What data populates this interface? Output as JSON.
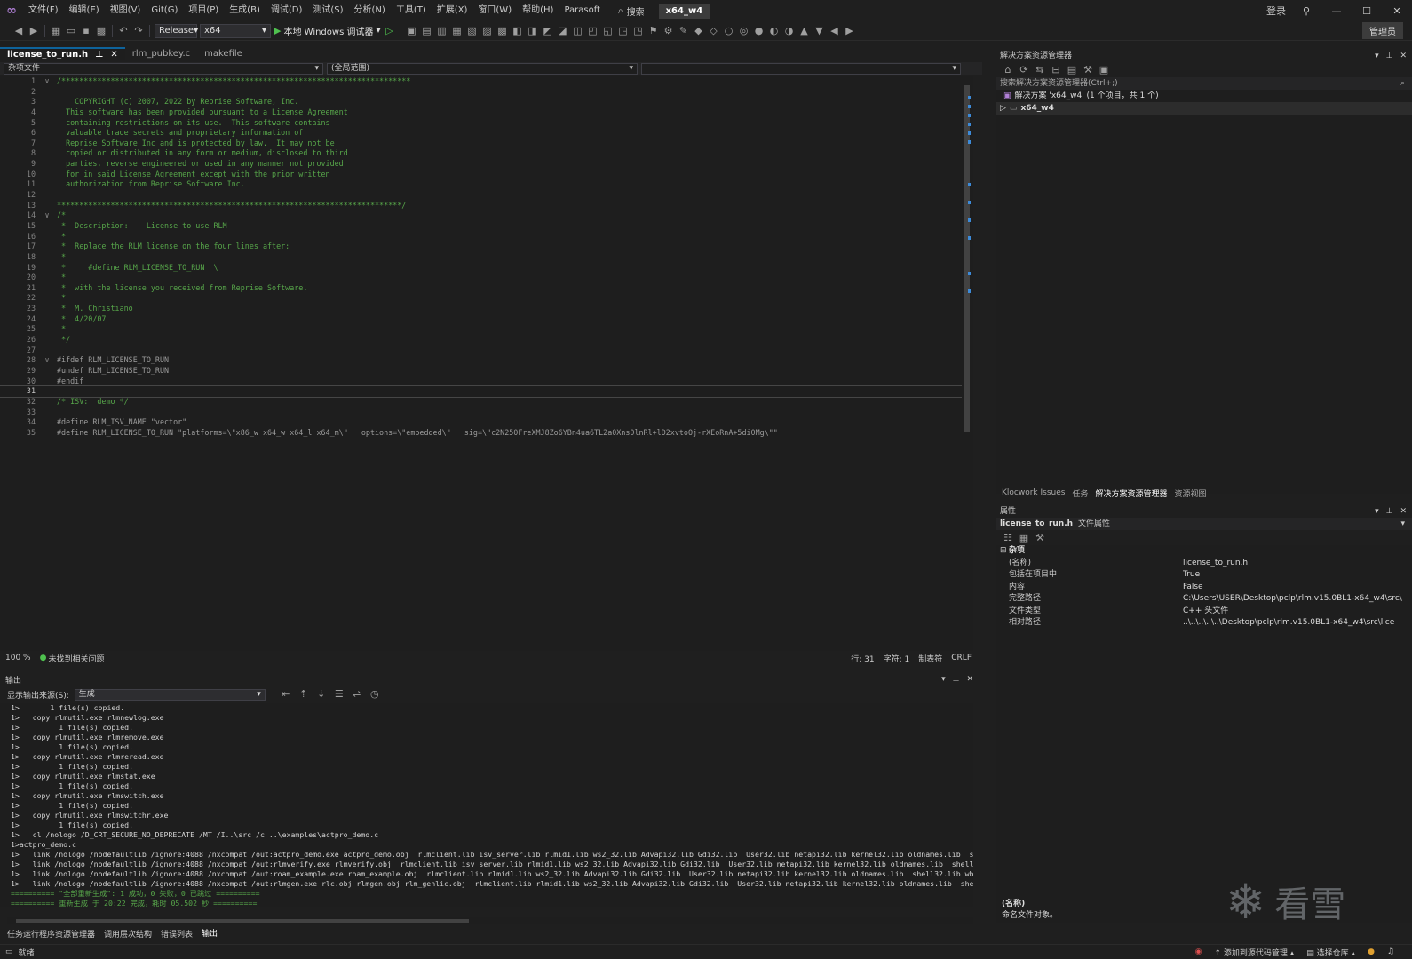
{
  "titlebar": {
    "menus": [
      "文件(F)",
      "编辑(E)",
      "视图(V)",
      "Git(G)",
      "项目(P)",
      "生成(B)",
      "调试(D)",
      "测试(S)",
      "分析(N)",
      "工具(T)",
      "扩展(X)",
      "窗口(W)",
      "帮助(H)",
      "Parasoft"
    ],
    "search_label": "搜索",
    "project_name": "x64_w4",
    "login_label": "登录"
  },
  "toolbar": {
    "configuration": "Release",
    "platform": "x64",
    "run_label": "本地 Windows 调试器",
    "admin_label": "管理员"
  },
  "editor": {
    "tabs": [
      {
        "label": "license_to_run.h",
        "active": true
      },
      {
        "label": "rlm_pubkey.c",
        "active": false
      },
      {
        "label": "makefile",
        "active": false
      }
    ],
    "nav_left": "杂项文件",
    "nav_middle": "(全局范围)",
    "lines": [
      {
        "n": "1",
        "text": "/******************************************************************************",
        "cls": ""
      },
      {
        "n": "2",
        "text": "",
        "cls": ""
      },
      {
        "n": "3",
        "text": "    COPYRIGHT (c) 2007, 2022 by Reprise Software, Inc.",
        "cls": ""
      },
      {
        "n": "4",
        "text": "  This software has been provided pursuant to a License Agreement",
        "cls": ""
      },
      {
        "n": "5",
        "text": "  containing restrictions on its use.  This software contains",
        "cls": ""
      },
      {
        "n": "6",
        "text": "  valuable trade secrets and proprietary information of",
        "cls": ""
      },
      {
        "n": "7",
        "text": "  Reprise Software Inc and is protected by law.  It may not be",
        "cls": ""
      },
      {
        "n": "8",
        "text": "  copied or distributed in any form or medium, disclosed to third",
        "cls": ""
      },
      {
        "n": "9",
        "text": "  parties, reverse engineered or used in any manner not provided",
        "cls": ""
      },
      {
        "n": "10",
        "text": "  for in said License Agreement except with the prior written",
        "cls": ""
      },
      {
        "n": "11",
        "text": "  authorization from Reprise Software Inc.",
        "cls": ""
      },
      {
        "n": "12",
        "text": "",
        "cls": ""
      },
      {
        "n": "13",
        "text": "*****************************************************************************/",
        "cls": ""
      },
      {
        "n": "14",
        "text": "/*",
        "cls": ""
      },
      {
        "n": "15",
        "text": " *  Description:    License to use RLM",
        "cls": ""
      },
      {
        "n": "16",
        "text": " *",
        "cls": ""
      },
      {
        "n": "17",
        "text": " *  Replace the RLM license on the four lines after:",
        "cls": ""
      },
      {
        "n": "18",
        "text": " *",
        "cls": ""
      },
      {
        "n": "19",
        "text": " *     #define RLM_LICENSE_TO_RUN  \\",
        "cls": ""
      },
      {
        "n": "20",
        "text": " *",
        "cls": ""
      },
      {
        "n": "21",
        "text": " *  with the license you received from Reprise Software.",
        "cls": ""
      },
      {
        "n": "22",
        "text": " *",
        "cls": ""
      },
      {
        "n": "23",
        "text": " *  M. Christiano",
        "cls": ""
      },
      {
        "n": "24",
        "text": " *  4/20/07",
        "cls": ""
      },
      {
        "n": "25",
        "text": " *",
        "cls": ""
      },
      {
        "n": "26",
        "text": " */",
        "cls": ""
      },
      {
        "n": "27",
        "text": "",
        "cls": ""
      },
      {
        "n": "28",
        "text": "#ifdef RLM_LICENSE_TO_RUN",
        "cls": "pp"
      },
      {
        "n": "29",
        "text": "#undef RLM_LICENSE_TO_RUN",
        "cls": "pp"
      },
      {
        "n": "30",
        "text": "#endif",
        "cls": "pp"
      },
      {
        "n": "31",
        "text": "",
        "cls": "pp"
      },
      {
        "n": "32",
        "text": "/* ISV:  demo */",
        "cls": ""
      },
      {
        "n": "33",
        "text": "",
        "cls": ""
      },
      {
        "n": "34",
        "text": "#define RLM_ISV_NAME \"vector\"",
        "cls": "pp"
      },
      {
        "n": "35",
        "text": "#define RLM_LICENSE_TO_RUN \"platforms=\\\"x86_w x64_w x64_l x64_m\\\"   options=\\\"embedded\\\"   sig=\\\"c2N250FreXMJ8Zo6YBn4ua6TL2a0Xns0lnRl+lD2xvtoOj-rXEoRnA+5di0Mg\\\"\"",
        "cls": "pp"
      }
    ],
    "status": {
      "zoom": "100 %",
      "issues": "未找到相关问题",
      "line": "行: 31",
      "col": "字符: 1",
      "mode": "制表符",
      "eol": "CRLF"
    }
  },
  "output": {
    "title": "输出",
    "source_label": "显示输出来源(S):",
    "source_value": "生成",
    "lines": [
      {
        "text": "1>       1 file(s) copied.",
        "cls": ""
      },
      {
        "text": "1>   copy rlmutil.exe rlmnewlog.exe",
        "cls": ""
      },
      {
        "text": "1>         1 file(s) copied.",
        "cls": ""
      },
      {
        "text": "1>   copy rlmutil.exe rlmremove.exe",
        "cls": ""
      },
      {
        "text": "1>         1 file(s) copied.",
        "cls": ""
      },
      {
        "text": "1>   copy rlmutil.exe rlmreread.exe",
        "cls": ""
      },
      {
        "text": "1>         1 file(s) copied.",
        "cls": ""
      },
      {
        "text": "1>   copy rlmutil.exe rlmstat.exe",
        "cls": ""
      },
      {
        "text": "1>         1 file(s) copied.",
        "cls": ""
      },
      {
        "text": "1>   copy rlmutil.exe rlmswitch.exe",
        "cls": ""
      },
      {
        "text": "1>         1 file(s) copied.",
        "cls": ""
      },
      {
        "text": "1>   copy rlmutil.exe rlmswitchr.exe",
        "cls": ""
      },
      {
        "text": "1>         1 file(s) copied.",
        "cls": ""
      },
      {
        "text": "1>   cl /nologo /D_CRT_SECURE_NO_DEPRECATE /MT /I..\\src /c ..\\examples\\actpro_demo.c",
        "cls": ""
      },
      {
        "text": "1>actpro_demo.c",
        "cls": ""
      },
      {
        "text": "1>   link /nologo /nodefaultlib /ignore:4088 /nxcompat /out:actpro_demo.exe actpro_demo.obj  rlmclient.lib isv_server.lib rlmid1.lib ws2_32.lib Advapi32.lib Gdi32.lib  User32.lib netapi32.lib kernel32.lib oldnames.lib  shell32.lib w",
        "cls": ""
      },
      {
        "text": "1>   link /nologo /nodefaultlib /ignore:4088 /nxcompat /out:rlmverify.exe rlmverify.obj  rlmclient.lib isv_server.lib rlmid1.lib ws2_32.lib Advapi32.lib Gdi32.lib  User32.lib netapi32.lib kernel32.lib oldnames.lib  shell32.lib wbemu",
        "cls": ""
      },
      {
        "text": "1>   link /nologo /nodefaultlib /ignore:4088 /nxcompat /out:roam_example.exe roam_example.obj  rlmclient.lib rlmid1.lib ws2_32.lib Advapi32.lib Gdi32.lib  User32.lib netapi32.lib kernel32.lib oldnames.lib  shell32.lib wbemuuid.lib c",
        "cls": ""
      },
      {
        "text": "1>   link /nologo /nodefaultlib /ignore:4088 /nxcompat /out:rlmgen.exe rlc.obj rlmgen.obj rlm_genlic.obj  rlmclient.lib rlmid1.lib ws2_32.lib Advapi32.lib Gdi32.lib  User32.lib netapi32.lib kernel32.lib oldnames.lib  shell32.lib wbe",
        "cls": ""
      },
      {
        "text": "========== \"全部重新生成\": 1 成功，0 失败，0 已跳过 ==========",
        "cls": "ok"
      },
      {
        "text": "========== 重新生成 于 20:22 完成，耗时 05.502 秒 ==========",
        "cls": "ok"
      }
    ],
    "bottom_tabs": [
      "任务运行程序资源管理器",
      "调用层次结构",
      "错误列表",
      "输出"
    ]
  },
  "solution_explorer": {
    "title": "解决方案资源管理器",
    "search_placeholder": "搜索解决方案资源管理器(Ctrl+;)",
    "solution_item": "解决方案 'x64_w4' (1 个项目，共 1 个)",
    "project_item": "x64_w4",
    "tabs": [
      "Klocwork Issues",
      "任务",
      "解决方案资源管理器",
      "资源视图"
    ]
  },
  "properties": {
    "title": "属性",
    "object_name": "license_to_run.h",
    "object_type": "文件属性",
    "category": "杂项",
    "rows": [
      {
        "k": "(名称)",
        "v": "license_to_run.h"
      },
      {
        "k": "包括在项目中",
        "v": "True"
      },
      {
        "k": "内容",
        "v": "False"
      },
      {
        "k": "完整路径",
        "v": "C:\\Users\\USER\\Desktop\\pclp\\rlm.v15.0BL1-x64_w4\\src\\"
      },
      {
        "k": "文件类型",
        "v": "C++ 头文件"
      },
      {
        "k": "相对路径",
        "v": "..\\..\\..\\..\\..\\Desktop\\pclp\\rlm.v15.0BL1-x64_w4\\src\\lice"
      }
    ],
    "desc_title": "(名称)",
    "desc_text": "命名文件对象。"
  },
  "statusbar": {
    "ready": "就绪",
    "source_control": "添加到源代码管理",
    "repo": "选择仓库"
  },
  "watermark": {
    "text": "看雪"
  }
}
